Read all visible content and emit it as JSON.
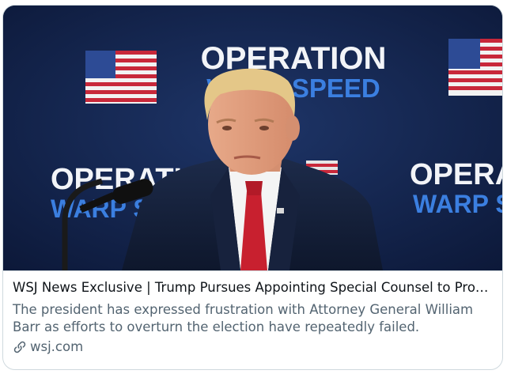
{
  "card": {
    "headline": "WSJ News Exclusive | Trump Pursues Appointing Special Counsel to Pro…",
    "description": "The president has expressed frustration with Attorney General William Barr as efforts to overturn the election have repeatedly failed.",
    "domain": "wsj.com",
    "link_icon": "link-icon"
  },
  "backdrop": {
    "line1": "OPERATION",
    "line2": "WARP SPEED",
    "left_line1": "OPERATION",
    "left_line2": "WARP SPE",
    "right_line1": "OPERAT",
    "right_line2": "WARP SPE"
  },
  "colors": {
    "background_navy": "#112046",
    "sign_white": "#f2f4f8",
    "sign_blue": "#3b7fe0",
    "headline": "#0f1419",
    "secondary": "#536471",
    "border": "#cfd9de"
  }
}
